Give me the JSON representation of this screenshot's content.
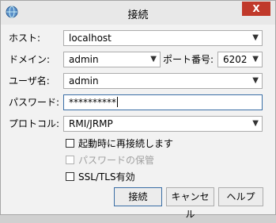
{
  "window": {
    "title": "接続",
    "close_glyph": "X"
  },
  "form": {
    "host_label": "ホスト:",
    "host_value": "localhost",
    "domain_label": "ドメイン:",
    "domain_value": "admin",
    "port_label": "ポート番号:",
    "port_value": "6202",
    "user_label": "ユーザ名:",
    "user_value": "admin",
    "password_label": "パスワード:",
    "password_value": "**********",
    "protocol_label": "プロトコル:",
    "protocol_value": "RMI/JRMP"
  },
  "options": {
    "reconnect_label": "起動時に再接続します",
    "save_password_label": "パスワードの保管",
    "ssl_label": "SSL/TLS有効"
  },
  "buttons": {
    "connect": "接続",
    "cancel": "キャンセル",
    "help": "ヘルプ"
  },
  "icons": {
    "dropdown": "▼"
  }
}
